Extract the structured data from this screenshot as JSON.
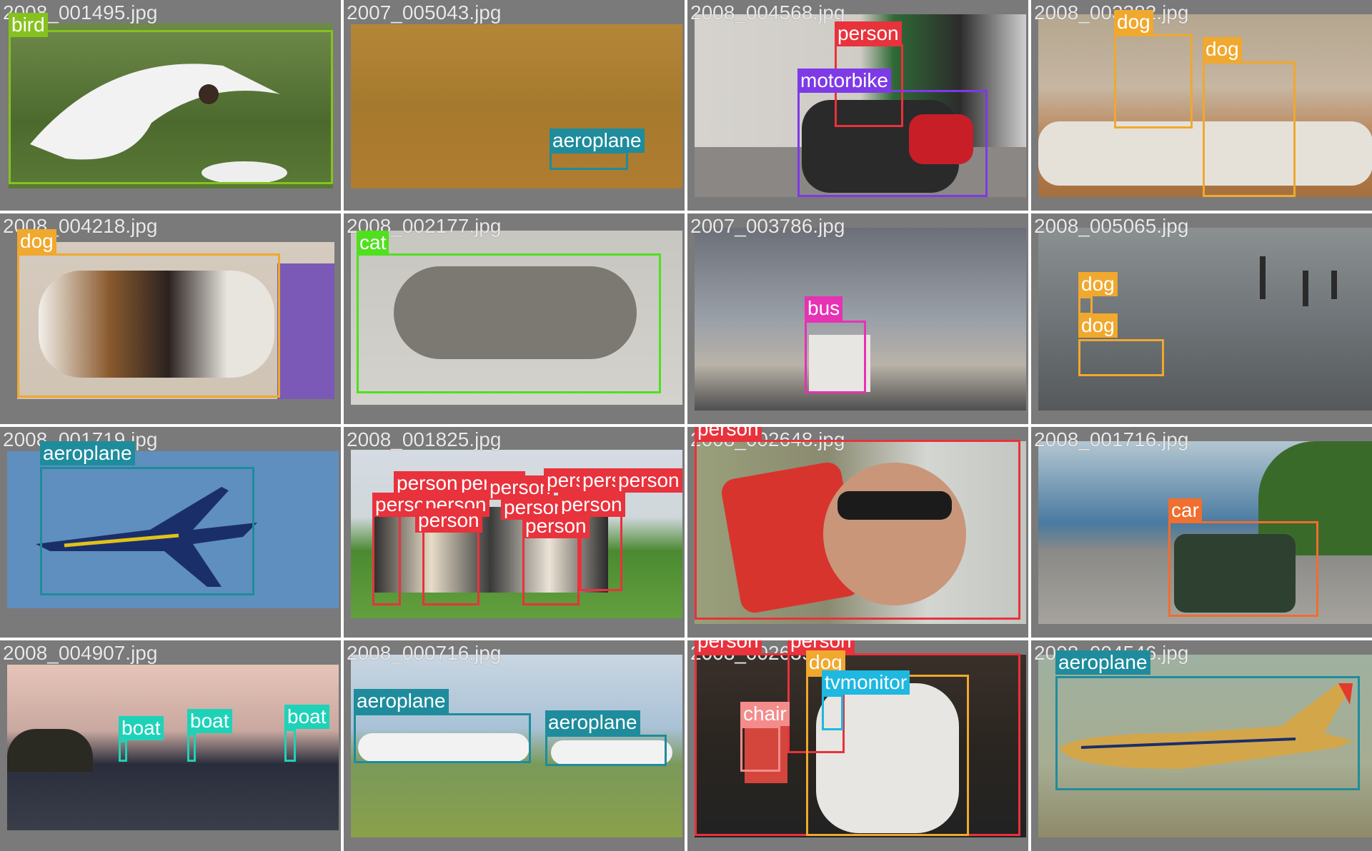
{
  "colors": {
    "bird": "#86c21e",
    "aeroplane": "#1e8c9c",
    "person": "#e8323c",
    "motorbike": "#7d3ae6",
    "dog": "#f0a82e",
    "cat": "#4fe01e",
    "bus": "#e632b4",
    "car": "#f06e2e",
    "boat": "#1ed2b8",
    "tvmonitor": "#1eb8e0",
    "chair": "#f48c8c"
  },
  "tiles": [
    {
      "file": "2008_001495.jpg",
      "labels": [
        {
          "text": "bird",
          "cls": "bird"
        }
      ]
    },
    {
      "file": "2007_005043.jpg",
      "labels": [
        {
          "text": "aeroplane",
          "cls": "aeroplane"
        }
      ]
    },
    {
      "file": "2008_004568.jpg",
      "labels": [
        {
          "text": "person",
          "cls": "person"
        },
        {
          "text": "motorbike",
          "cls": "motorbike"
        }
      ]
    },
    {
      "file": "2008_003382.jpg",
      "labels": [
        {
          "text": "dog",
          "cls": "dog"
        },
        {
          "text": "dog",
          "cls": "dog"
        }
      ]
    },
    {
      "file": "2008_004218.jpg",
      "labels": [
        {
          "text": "dog",
          "cls": "dog"
        }
      ]
    },
    {
      "file": "2008_002177.jpg",
      "labels": [
        {
          "text": "cat",
          "cls": "cat"
        }
      ]
    },
    {
      "file": "2007_003786.jpg",
      "labels": [
        {
          "text": "bus",
          "cls": "bus"
        }
      ]
    },
    {
      "file": "2008_005065.jpg",
      "labels": [
        {
          "text": "dog",
          "cls": "dog"
        },
        {
          "text": "dog",
          "cls": "dog"
        }
      ]
    },
    {
      "file": "2008_001719.jpg",
      "labels": [
        {
          "text": "aeroplane",
          "cls": "aeroplane"
        }
      ]
    },
    {
      "file": "2008_001825.jpg",
      "labels": [
        {
          "text": "person",
          "cls": "person"
        },
        {
          "text": "person",
          "cls": "person"
        },
        {
          "text": "person",
          "cls": "person"
        },
        {
          "text": "person",
          "cls": "person"
        },
        {
          "text": "person",
          "cls": "person"
        },
        {
          "text": "person",
          "cls": "person"
        },
        {
          "text": "person",
          "cls": "person"
        },
        {
          "text": "person",
          "cls": "person"
        },
        {
          "text": "person",
          "cls": "person"
        },
        {
          "text": "person",
          "cls": "person"
        },
        {
          "text": "person",
          "cls": "person"
        },
        {
          "text": "person",
          "cls": "person"
        }
      ]
    },
    {
      "file": "2008_002648.jpg",
      "labels": [
        {
          "text": "person",
          "cls": "person"
        }
      ]
    },
    {
      "file": "2008_001716.jpg",
      "labels": [
        {
          "text": "car",
          "cls": "car"
        }
      ]
    },
    {
      "file": "2008_004907.jpg",
      "labels": [
        {
          "text": "boat",
          "cls": "boat"
        },
        {
          "text": "boat",
          "cls": "boat"
        },
        {
          "text": "boat",
          "cls": "boat"
        }
      ]
    },
    {
      "file": "2008_000716.jpg",
      "labels": [
        {
          "text": "aeroplane",
          "cls": "aeroplane"
        },
        {
          "text": "aeroplane",
          "cls": "aeroplane"
        }
      ]
    },
    {
      "file": "2008_002639.jpg",
      "labels": [
        {
          "text": "person",
          "cls": "person"
        },
        {
          "text": "person",
          "cls": "person"
        },
        {
          "text": "dog",
          "cls": "dog"
        },
        {
          "text": "tvmonitor",
          "cls": "tvmonitor"
        },
        {
          "text": "chair",
          "cls": "chair"
        }
      ]
    },
    {
      "file": "2008_004546.jpg",
      "labels": [
        {
          "text": "aeroplane",
          "cls": "aeroplane"
        }
      ]
    }
  ]
}
